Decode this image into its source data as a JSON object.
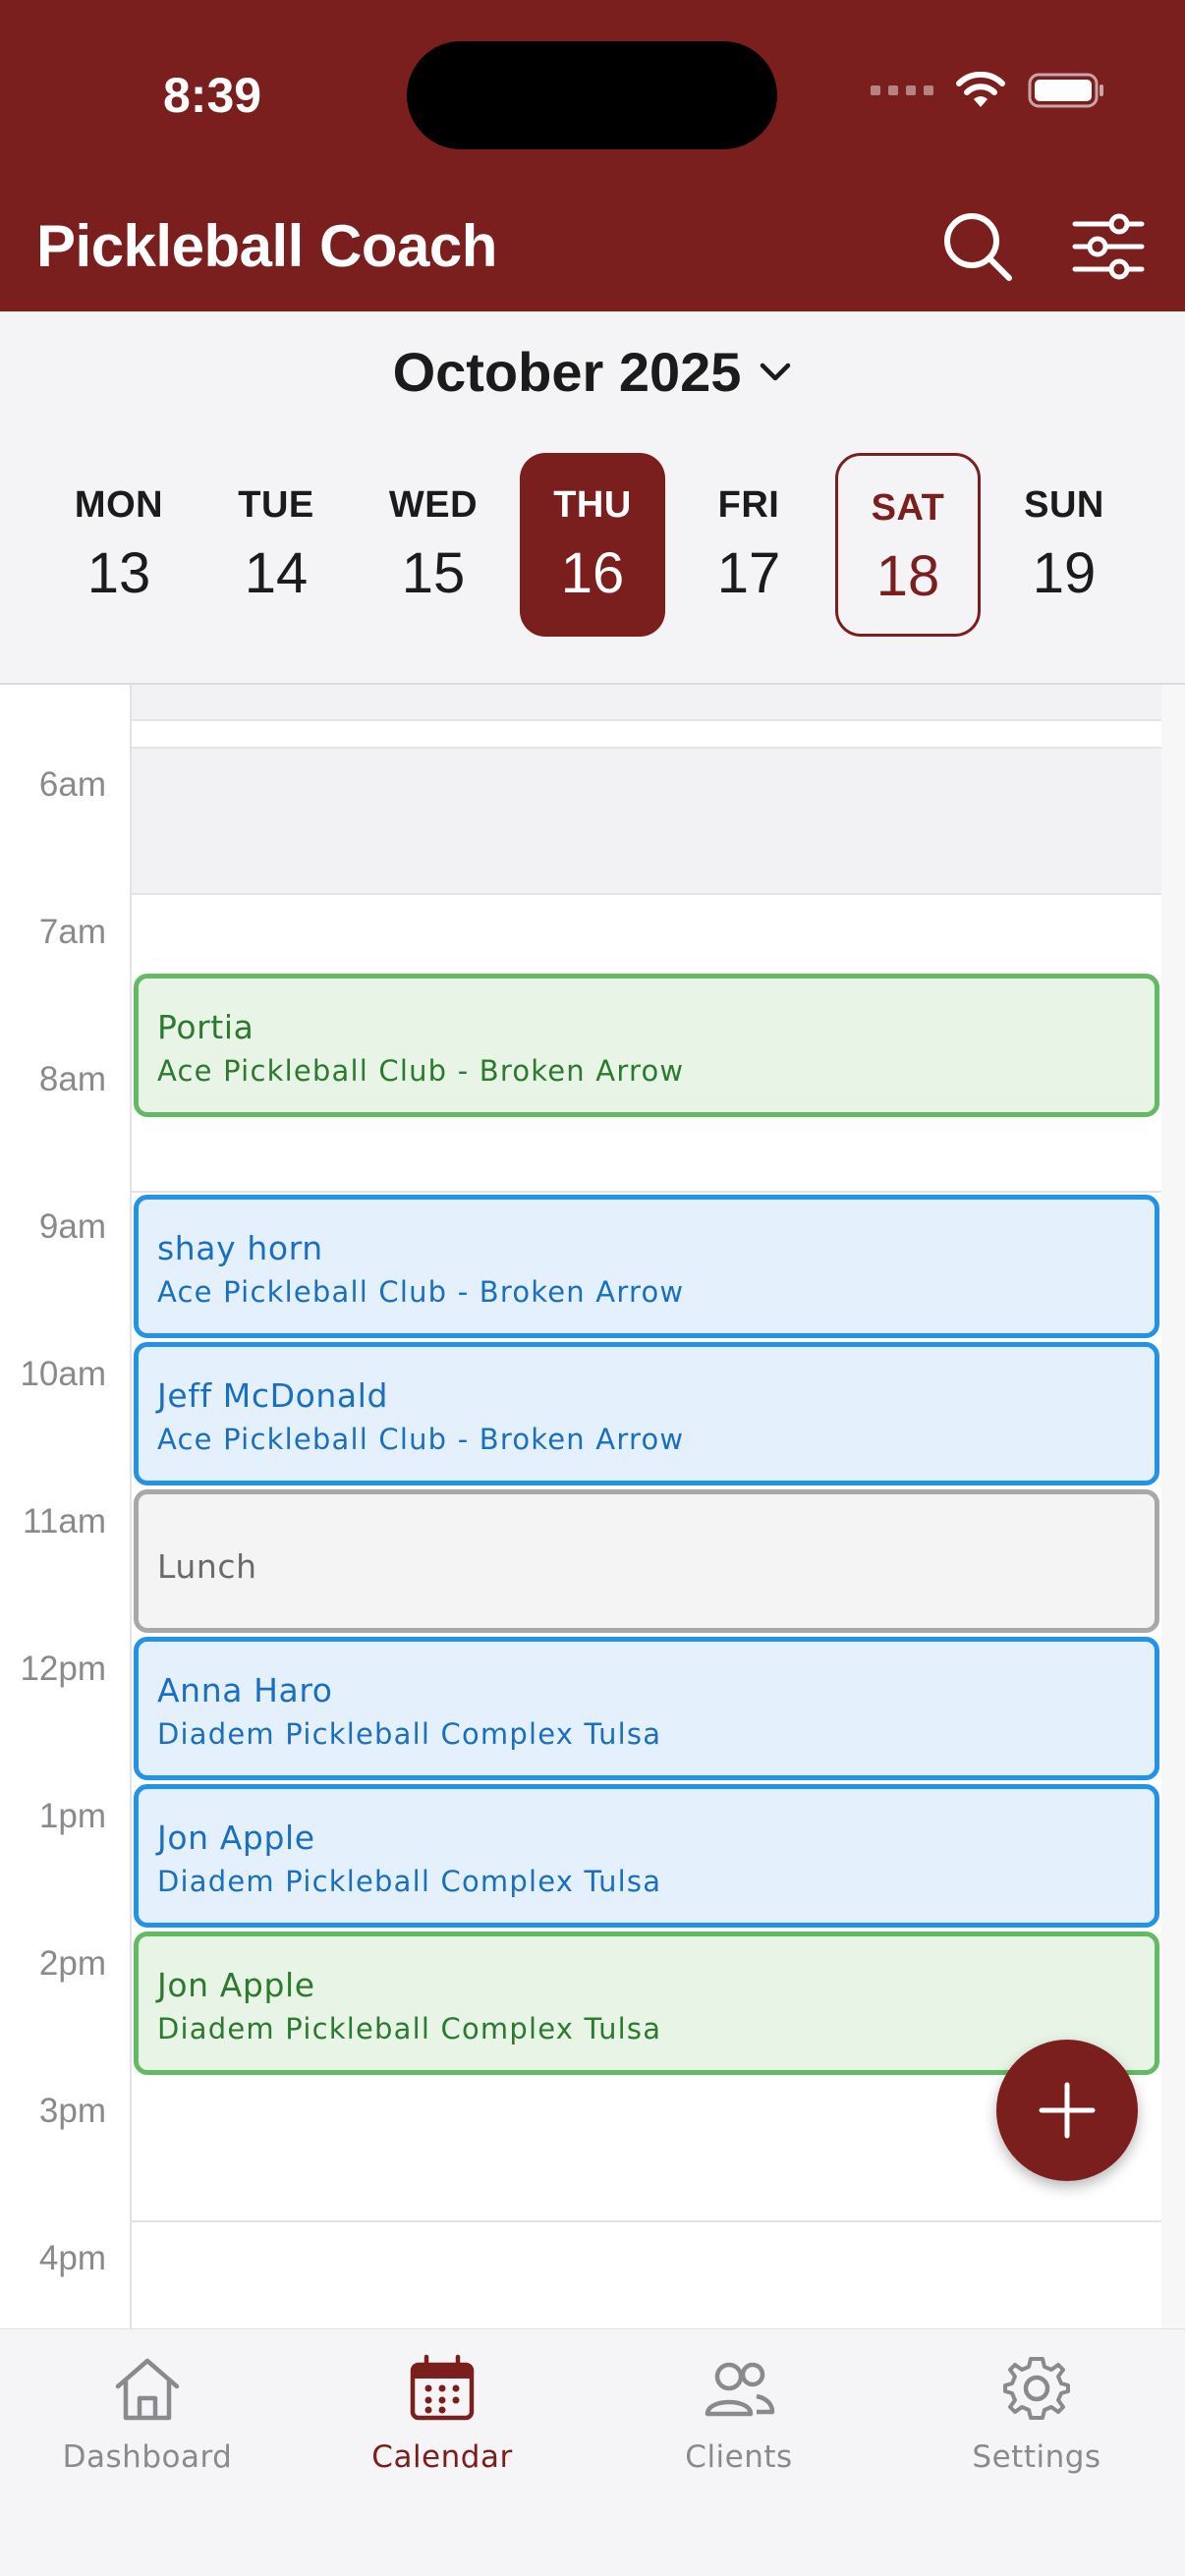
{
  "status_bar": {
    "time": "8:39"
  },
  "header": {
    "title": "Pickleball Coach",
    "search_icon": "search-icon",
    "filter_icon": "sliders-icon",
    "bg_color": "#7b1e1e"
  },
  "week": {
    "month_label": "October 2025",
    "days": [
      {
        "name": "MON",
        "date": "13",
        "state": "normal"
      },
      {
        "name": "TUE",
        "date": "14",
        "state": "normal"
      },
      {
        "name": "WED",
        "date": "15",
        "state": "normal"
      },
      {
        "name": "THU",
        "date": "16",
        "state": "selected"
      },
      {
        "name": "FRI",
        "date": "17",
        "state": "normal"
      },
      {
        "name": "SAT",
        "date": "18",
        "state": "today"
      },
      {
        "name": "SUN",
        "date": "19",
        "state": "normal"
      }
    ]
  },
  "timeline": {
    "hours": [
      "6am",
      "7am",
      "8am",
      "9am",
      "10am",
      "11am",
      "12pm",
      "1pm",
      "2pm",
      "3pm",
      "4pm"
    ],
    "events": [
      {
        "name": "Portia",
        "location": "Ace Pickleball Club - Broken Arrow",
        "color": "green"
      },
      {
        "name": "shay horn",
        "location": "Ace Pickleball Club - Broken Arrow",
        "color": "blue"
      },
      {
        "name": "Jeff McDonald",
        "location": "Ace Pickleball Club - Broken Arrow",
        "color": "blue"
      },
      {
        "name": "Lunch",
        "location": "",
        "color": "gray"
      },
      {
        "name": "Anna Haro",
        "location": "Diadem Pickleball Complex Tulsa",
        "color": "blue"
      },
      {
        "name": "Jon Apple",
        "location": "Diadem Pickleball Complex Tulsa",
        "color": "blue"
      },
      {
        "name": "Jon Apple",
        "location": "Diadem Pickleball Complex Tulsa",
        "color": "green"
      }
    ]
  },
  "fab": {
    "icon": "plus-icon"
  },
  "tabbar": {
    "tabs": [
      {
        "label": "Dashboard",
        "icon": "home-icon",
        "active": false
      },
      {
        "label": "Calendar",
        "icon": "calendar-icon",
        "active": true
      },
      {
        "label": "Clients",
        "icon": "people-icon",
        "active": false
      },
      {
        "label": "Settings",
        "icon": "gear-icon",
        "active": false
      }
    ]
  }
}
